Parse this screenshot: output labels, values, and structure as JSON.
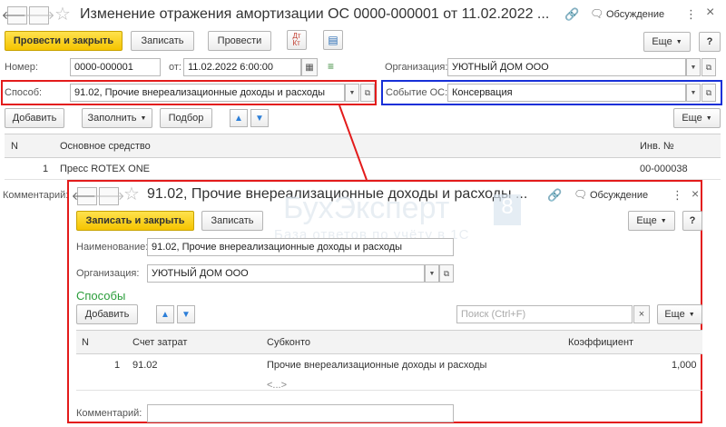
{
  "window": {
    "title": "Изменение отражения амортизации ОС 0000-000001 от 11.02.2022 ...",
    "discussion": "Обсуждение",
    "more_menu": "⋮",
    "close": "×"
  },
  "toolbar": {
    "post_close": "Провести и закрыть",
    "save": "Записать",
    "post": "Провести",
    "more": "Еще",
    "help": "?"
  },
  "header": {
    "number_label": "Номер:",
    "number_value": "0000-000001",
    "date_label": "от:",
    "date_value": "11.02.2022  6:00:00",
    "org_label": "Организация:",
    "org_value": "УЮТНЫЙ ДОМ ООО",
    "method_label": "Способ:",
    "method_value": "91.02, Прочие внереализационные доходы и расходы",
    "event_label": "Событие ОС:",
    "event_value": "Консервация"
  },
  "table_toolbar": {
    "add": "Добавить",
    "fill": "Заполнить",
    "select": "Подбор",
    "more": "Еще"
  },
  "table": {
    "columns": [
      "N",
      "Основное средство",
      "Инв. №"
    ],
    "rows": [
      {
        "n": "1",
        "asset": "Пресс ROTEX ONE",
        "inv": "00-000038"
      }
    ]
  },
  "comment_label": "Комментарий:",
  "dialog": {
    "title": "91.02, Прочие внереализационные доходы и расходы ...",
    "discussion": "Обсуждение",
    "more_menu": "⋮",
    "close": "×",
    "save_close": "Записать и закрыть",
    "save": "Записать",
    "more": "Еще",
    "help": "?",
    "name_label": "Наименование:",
    "name_value": "91.02, Прочие внереализационные доходы и расходы",
    "org_label": "Организация:",
    "org_value": "УЮТНЫЙ ДОМ ООО",
    "section_title": "Способы",
    "add": "Добавить",
    "search_placeholder": "Поиск (Ctrl+F)",
    "search_clear": "×",
    "more2": "Еще",
    "columns": [
      "N",
      "Счет затрат",
      "Субконто",
      "Коэффициент"
    ],
    "rows": [
      {
        "n": "1",
        "account": "91.02",
        "subconto": "Прочие внереализационные доходы и расходы",
        "subconto2": "<...>",
        "coef": "1,000"
      }
    ],
    "comment_label": "Комментарий:",
    "watermark_1": "БухЭксперт",
    "watermark_badge": "8",
    "watermark_2": "База ответов по учёту в 1С"
  },
  "colors": {
    "highlight_red": "#e31b1b",
    "highlight_blue": "#1730d8",
    "button_yellow": "#f5c400",
    "section_green": "#2a9d3a"
  }
}
